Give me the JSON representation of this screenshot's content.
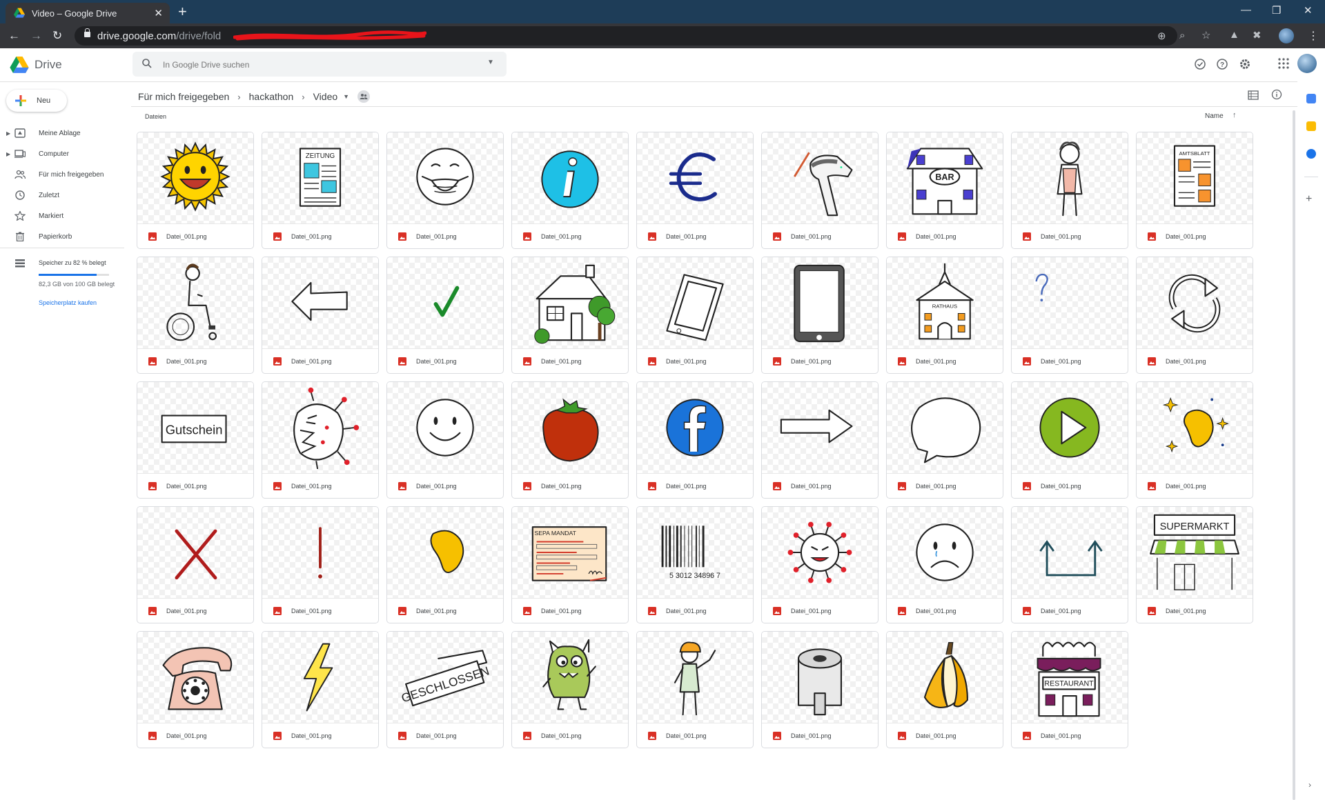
{
  "browser": {
    "tab_title": "Video – Google Drive",
    "url_main": "drive.google.com",
    "url_path": "/drive/fold"
  },
  "header": {
    "app_name": "Drive",
    "search_placeholder": "In Google Drive suchen"
  },
  "sidebar": {
    "new_label": "Neu",
    "items": [
      {
        "label": "Meine Ablage",
        "icon": "my-drive-icon"
      },
      {
        "label": "Computer",
        "icon": "computer-icon"
      },
      {
        "label": "Für mich freigegeben",
        "icon": "shared-with-me-icon"
      },
      {
        "label": "Zuletzt",
        "icon": "clock-icon"
      },
      {
        "label": "Markiert",
        "icon": "star-icon"
      },
      {
        "label": "Papierkorb",
        "icon": "trash-icon"
      }
    ],
    "storage": {
      "title": "Speicher zu 82 % belegt",
      "used_percent": 82,
      "detail": "82,3 GB von 100 GB belegt",
      "buy": "Speicherplatz kaufen"
    }
  },
  "breadcrumb": {
    "items": [
      "Für mich freigegeben",
      "hackathon",
      "Video"
    ]
  },
  "section_label": "Dateien",
  "sort_label": "Name",
  "colors": {
    "accent": "#1a73e8",
    "png_icon": "#d93025",
    "tabstrip": "#1e3d58"
  },
  "files": [
    {
      "name": "Datei_001.png",
      "thumb": "sun"
    },
    {
      "name": "Datei_001.png",
      "thumb": "newspaper"
    },
    {
      "name": "Datei_001.png",
      "thumb": "mask-face"
    },
    {
      "name": "Datei_001.png",
      "thumb": "info"
    },
    {
      "name": "Datei_001.png",
      "thumb": "euro"
    },
    {
      "name": "Datei_001.png",
      "thumb": "scanner"
    },
    {
      "name": "Datei_001.png",
      "thumb": "bar"
    },
    {
      "name": "Datei_001.png",
      "thumb": "old-woman"
    },
    {
      "name": "Datei_001.png",
      "thumb": "amtsblatt"
    },
    {
      "name": "Datei_001.png",
      "thumb": "wheelchair"
    },
    {
      "name": "Datei_001.png",
      "thumb": "arrow-left"
    },
    {
      "name": "Datei_001.png",
      "thumb": "checkmark"
    },
    {
      "name": "Datei_001.png",
      "thumb": "house"
    },
    {
      "name": "Datei_001.png",
      "thumb": "phone-tilted"
    },
    {
      "name": "Datei_001.png",
      "thumb": "tablet"
    },
    {
      "name": "Datei_001.png",
      "thumb": "rathaus"
    },
    {
      "name": "Datei_001.png",
      "thumb": "question"
    },
    {
      "name": "Datei_001.png",
      "thumb": "refresh"
    },
    {
      "name": "Datei_001.png",
      "thumb": "gutschein"
    },
    {
      "name": "Datei_001.png",
      "thumb": "virus-monster"
    },
    {
      "name": "Datei_001.png",
      "thumb": "smiley"
    },
    {
      "name": "Datei_001.png",
      "thumb": "tomato"
    },
    {
      "name": "Datei_001.png",
      "thumb": "facebook"
    },
    {
      "name": "Datei_001.png",
      "thumb": "arrow-right"
    },
    {
      "name": "Datei_001.png",
      "thumb": "speech-bubble"
    },
    {
      "name": "Datei_001.png",
      "thumb": "play"
    },
    {
      "name": "Datei_001.png",
      "thumb": "bean-sparkle"
    },
    {
      "name": "Datei_001.png",
      "thumb": "cross"
    },
    {
      "name": "Datei_001.png",
      "thumb": "exclamation"
    },
    {
      "name": "Datei_001.png",
      "thumb": "bean"
    },
    {
      "name": "Datei_001.png",
      "thumb": "sepa"
    },
    {
      "name": "Datei_001.png",
      "thumb": "barcode"
    },
    {
      "name": "Datei_001.png",
      "thumb": "virus"
    },
    {
      "name": "Datei_001.png",
      "thumb": "sad-face"
    },
    {
      "name": "Datei_001.png",
      "thumb": "u-arrow"
    },
    {
      "name": "Datei_001.png",
      "thumb": "supermarkt"
    },
    {
      "name": "Datei_001.png",
      "thumb": "telephone"
    },
    {
      "name": "Datei_001.png",
      "thumb": "lightning"
    },
    {
      "name": "Datei_001.png",
      "thumb": "geschlossen"
    },
    {
      "name": "Datei_001.png",
      "thumb": "monster"
    },
    {
      "name": "Datei_001.png",
      "thumb": "worker"
    },
    {
      "name": "Datei_001.png",
      "thumb": "toilet-paper"
    },
    {
      "name": "Datei_001.png",
      "thumb": "banana"
    },
    {
      "name": "Datei_001.png",
      "thumb": "restaurant"
    }
  ],
  "thumb_labels": {
    "zeitung": "ZEITUNG",
    "bar": "BAR",
    "amtsblatt": "AMTSBLATT",
    "rathaus": "RATHAUS",
    "gutschein": "Gutschein",
    "sepa": "SEPA MANDAT",
    "barcode_num": "5 3012 34896 7",
    "supermarkt": "SUPERMARKT",
    "geschlossen": "GESCHLOSSEN",
    "restaurant": "RESTAURANT"
  }
}
